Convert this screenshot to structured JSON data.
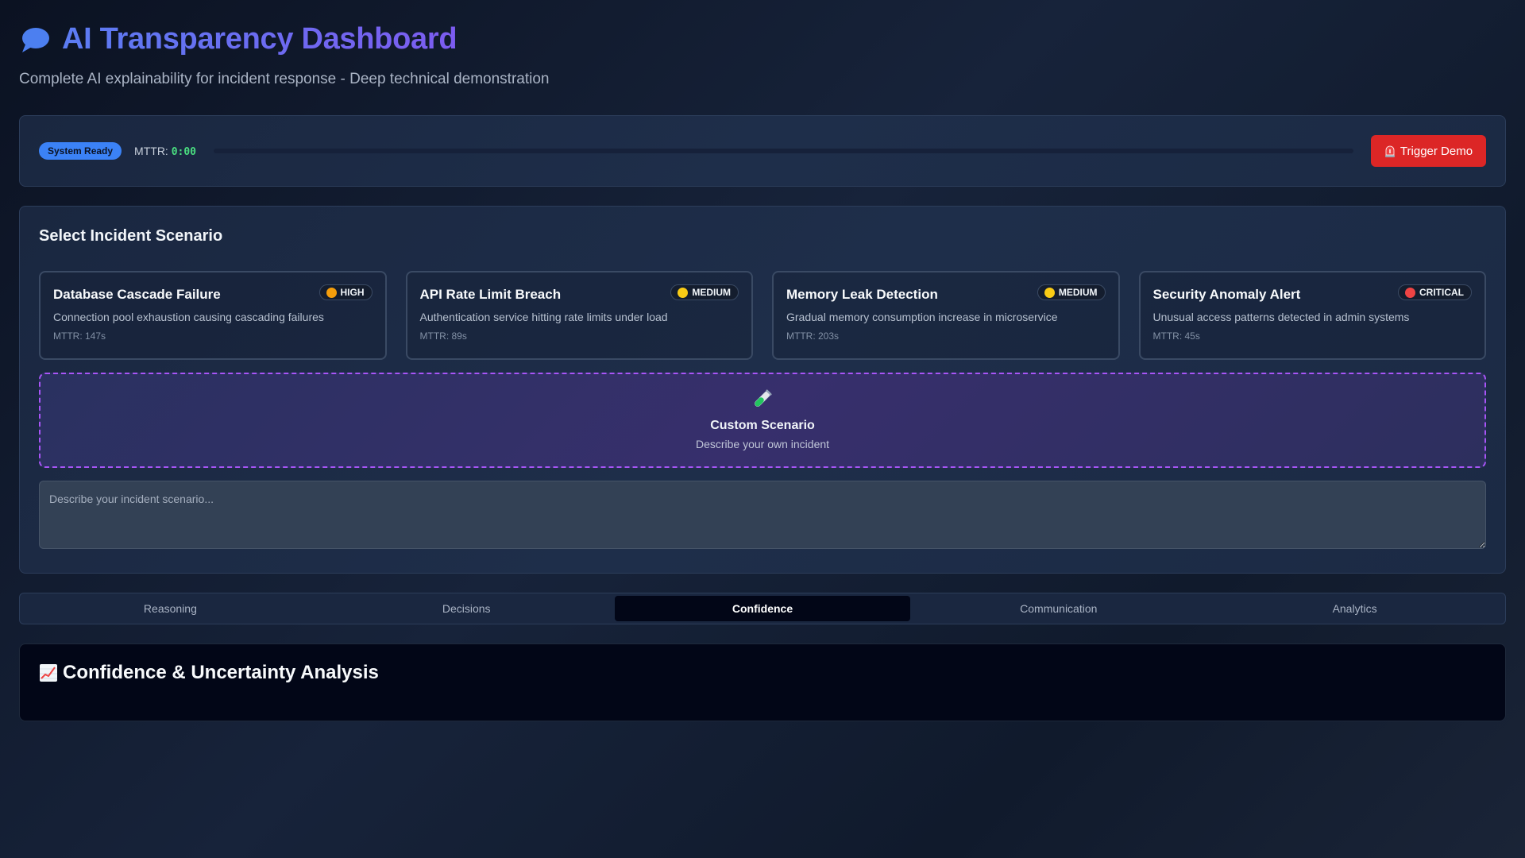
{
  "header": {
    "title": "AI Transparency Dashboard",
    "subtitle": "Complete AI explainability for incident response - Deep technical demonstration",
    "icon": "speech-bubble-icon"
  },
  "status_bar": {
    "status_badge": "System Ready",
    "mttr_label": "MTTR:",
    "mttr_value": "0:00",
    "progress": 0,
    "trigger_label": "Trigger Demo",
    "trigger_icon": "siren-icon"
  },
  "scenarios": {
    "title": "Select Incident Scenario",
    "cards": [
      {
        "title": "Database Cascade Failure",
        "severity": "HIGH",
        "severity_color": "#f59e0b",
        "description": "Connection pool exhaustion causing cascading failures",
        "mttr": "MTTR: 147s"
      },
      {
        "title": "API Rate Limit Breach",
        "severity": "MEDIUM",
        "severity_color": "#facc15",
        "description": "Authentication service hitting rate limits under load",
        "mttr": "MTTR: 89s"
      },
      {
        "title": "Memory Leak Detection",
        "severity": "MEDIUM",
        "severity_color": "#facc15",
        "description": "Gradual memory consumption increase in microservice",
        "mttr": "MTTR: 203s"
      },
      {
        "title": "Security Anomaly Alert",
        "severity": "CRITICAL",
        "severity_color": "#ef4444",
        "description": "Unusual access patterns detected in admin systems",
        "mttr": "MTTR: 45s"
      }
    ],
    "custom": {
      "icon": "test-tube-icon",
      "title": "Custom Scenario",
      "subtitle": "Describe your own incident",
      "placeholder": "Describe your incident scenario..."
    }
  },
  "tabs": [
    {
      "label": "Reasoning",
      "active": false
    },
    {
      "label": "Decisions",
      "active": false
    },
    {
      "label": "Confidence",
      "active": true
    },
    {
      "label": "Communication",
      "active": false
    },
    {
      "label": "Analytics",
      "active": false
    }
  ],
  "content": {
    "icon": "chart-increasing-icon",
    "title": "Confidence & Uncertainty Analysis"
  },
  "colors": {
    "accent": "#3b82f6",
    "danger": "#dc2626",
    "success": "#4ade80",
    "custom_border": "#a855f7"
  }
}
